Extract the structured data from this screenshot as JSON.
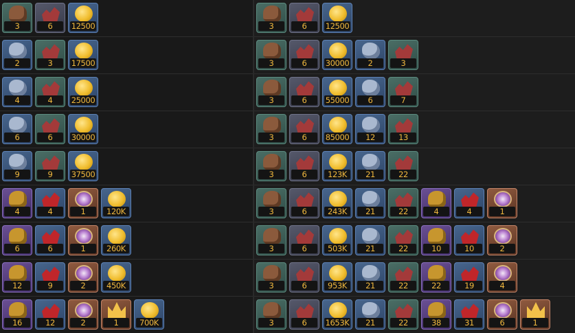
{
  "resources": {
    "bag": "brown-sack-icon",
    "hide": "red-hide-icon",
    "coin": "gold-coin-icon",
    "ore": "blue-ore-icon",
    "gold_bag": "golden-sack-icon",
    "rich_hide": "crimson-hide-icon",
    "orb": "purple-orb-icon",
    "crown": "gold-crown-icon"
  },
  "rows": [
    {
      "left": [
        {
          "r": "bag",
          "q": "3",
          "t": "green"
        },
        {
          "r": "hide",
          "q": "6",
          "t": "slate"
        },
        {
          "r": "coin",
          "q": "12500",
          "t": "blue"
        }
      ],
      "right": [
        {
          "r": "bag",
          "q": "3",
          "t": "green"
        },
        {
          "r": "hide",
          "q": "6",
          "t": "slate"
        },
        {
          "r": "coin",
          "q": "12500",
          "t": "blue"
        }
      ]
    },
    {
      "left": [
        {
          "r": "ore",
          "q": "2",
          "t": "blue"
        },
        {
          "r": "hide",
          "q": "3",
          "t": "green"
        },
        {
          "r": "coin",
          "q": "17500",
          "t": "blue"
        }
      ],
      "right": [
        {
          "r": "bag",
          "q": "3",
          "t": "green"
        },
        {
          "r": "hide",
          "q": "6",
          "t": "slate"
        },
        {
          "r": "coin",
          "q": "30000",
          "t": "blue"
        },
        {
          "r": "ore",
          "q": "2",
          "t": "blue"
        },
        {
          "r": "hide",
          "q": "3",
          "t": "green"
        }
      ]
    },
    {
      "left": [
        {
          "r": "ore",
          "q": "4",
          "t": "blue"
        },
        {
          "r": "hide",
          "q": "4",
          "t": "green"
        },
        {
          "r": "coin",
          "q": "25000",
          "t": "blue"
        }
      ],
      "right": [
        {
          "r": "bag",
          "q": "3",
          "t": "green"
        },
        {
          "r": "hide",
          "q": "6",
          "t": "slate"
        },
        {
          "r": "coin",
          "q": "55000",
          "t": "blue"
        },
        {
          "r": "ore",
          "q": "6",
          "t": "blue"
        },
        {
          "r": "hide",
          "q": "7",
          "t": "green"
        }
      ]
    },
    {
      "left": [
        {
          "r": "ore",
          "q": "6",
          "t": "blue"
        },
        {
          "r": "hide",
          "q": "6",
          "t": "green"
        },
        {
          "r": "coin",
          "q": "30000",
          "t": "blue"
        }
      ],
      "right": [
        {
          "r": "bag",
          "q": "3",
          "t": "green"
        },
        {
          "r": "hide",
          "q": "6",
          "t": "slate"
        },
        {
          "r": "coin",
          "q": "85000",
          "t": "blue"
        },
        {
          "r": "ore",
          "q": "12",
          "t": "blue"
        },
        {
          "r": "hide",
          "q": "13",
          "t": "green"
        }
      ]
    },
    {
      "left": [
        {
          "r": "ore",
          "q": "9",
          "t": "blue"
        },
        {
          "r": "hide",
          "q": "9",
          "t": "green"
        },
        {
          "r": "coin",
          "q": "37500",
          "t": "blue"
        }
      ],
      "right": [
        {
          "r": "bag",
          "q": "3",
          "t": "green"
        },
        {
          "r": "hide",
          "q": "6",
          "t": "slate"
        },
        {
          "r": "coin",
          "q": "123K",
          "t": "blue"
        },
        {
          "r": "ore",
          "q": "21",
          "t": "blue"
        },
        {
          "r": "hide",
          "q": "22",
          "t": "green"
        }
      ]
    },
    {
      "left": [
        {
          "r": "gold_bag",
          "q": "4",
          "t": "purple"
        },
        {
          "r": "rich_hide",
          "q": "4",
          "t": "blue"
        },
        {
          "r": "orb",
          "q": "1",
          "t": "orange"
        },
        {
          "r": "coin",
          "q": "120K",
          "t": "blue"
        }
      ],
      "right": [
        {
          "r": "bag",
          "q": "3",
          "t": "green"
        },
        {
          "r": "hide",
          "q": "6",
          "t": "slate"
        },
        {
          "r": "coin",
          "q": "243K",
          "t": "blue"
        },
        {
          "r": "ore",
          "q": "21",
          "t": "blue"
        },
        {
          "r": "hide",
          "q": "22",
          "t": "green"
        },
        {
          "r": "gold_bag",
          "q": "4",
          "t": "purple"
        },
        {
          "r": "rich_hide",
          "q": "4",
          "t": "blue"
        },
        {
          "r": "orb",
          "q": "1",
          "t": "orange"
        }
      ]
    },
    {
      "left": [
        {
          "r": "gold_bag",
          "q": "6",
          "t": "purple"
        },
        {
          "r": "rich_hide",
          "q": "6",
          "t": "blue"
        },
        {
          "r": "orb",
          "q": "1",
          "t": "orange"
        },
        {
          "r": "coin",
          "q": "260K",
          "t": "blue"
        }
      ],
      "right": [
        {
          "r": "bag",
          "q": "3",
          "t": "green"
        },
        {
          "r": "hide",
          "q": "6",
          "t": "slate"
        },
        {
          "r": "coin",
          "q": "503K",
          "t": "blue"
        },
        {
          "r": "ore",
          "q": "21",
          "t": "blue"
        },
        {
          "r": "hide",
          "q": "22",
          "t": "green"
        },
        {
          "r": "gold_bag",
          "q": "10",
          "t": "purple"
        },
        {
          "r": "rich_hide",
          "q": "10",
          "t": "blue"
        },
        {
          "r": "orb",
          "q": "2",
          "t": "orange"
        }
      ]
    },
    {
      "left": [
        {
          "r": "gold_bag",
          "q": "12",
          "t": "purple"
        },
        {
          "r": "rich_hide",
          "q": "9",
          "t": "blue"
        },
        {
          "r": "orb",
          "q": "2",
          "t": "orange"
        },
        {
          "r": "coin",
          "q": "450K",
          "t": "blue"
        }
      ],
      "right": [
        {
          "r": "bag",
          "q": "3",
          "t": "green"
        },
        {
          "r": "hide",
          "q": "6",
          "t": "slate"
        },
        {
          "r": "coin",
          "q": "953K",
          "t": "blue"
        },
        {
          "r": "ore",
          "q": "21",
          "t": "blue"
        },
        {
          "r": "hide",
          "q": "22",
          "t": "green"
        },
        {
          "r": "gold_bag",
          "q": "22",
          "t": "purple"
        },
        {
          "r": "rich_hide",
          "q": "19",
          "t": "blue"
        },
        {
          "r": "orb",
          "q": "4",
          "t": "orange"
        }
      ]
    },
    {
      "left": [
        {
          "r": "gold_bag",
          "q": "16",
          "t": "purple"
        },
        {
          "r": "rich_hide",
          "q": "12",
          "t": "blue"
        },
        {
          "r": "orb",
          "q": "2",
          "t": "orange"
        },
        {
          "r": "crown",
          "q": "1",
          "t": "orange"
        },
        {
          "r": "coin",
          "q": "700K",
          "t": "blue"
        }
      ],
      "right": [
        {
          "r": "bag",
          "q": "3",
          "t": "green"
        },
        {
          "r": "hide",
          "q": "6",
          "t": "slate"
        },
        {
          "r": "coin",
          "q": "1653K",
          "t": "blue"
        },
        {
          "r": "ore",
          "q": "21",
          "t": "blue"
        },
        {
          "r": "hide",
          "q": "22",
          "t": "green"
        },
        {
          "r": "gold_bag",
          "q": "38",
          "t": "purple"
        },
        {
          "r": "rich_hide",
          "q": "31",
          "t": "blue"
        },
        {
          "r": "orb",
          "q": "6",
          "t": "orange"
        },
        {
          "r": "crown",
          "q": "1",
          "t": "orange"
        }
      ]
    }
  ]
}
